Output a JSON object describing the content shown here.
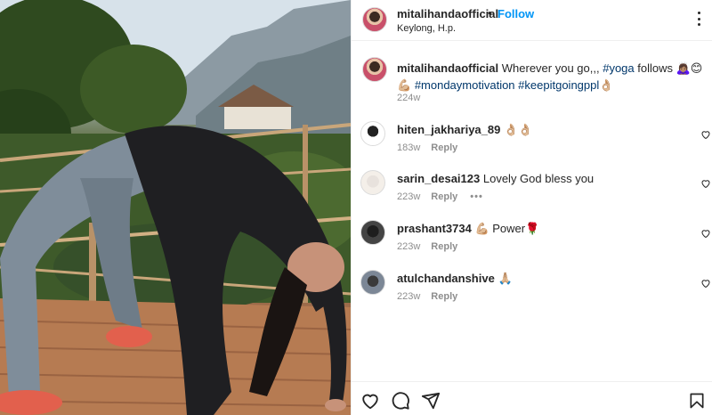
{
  "post": {
    "username": "mitalihandaofficial",
    "dot": "•",
    "follow_label": "Follow",
    "location": "Keylong, H.p."
  },
  "caption": {
    "username": "mitalihandaofficial",
    "text": "Wherever you go,,,",
    "tag_yoga": "#yoga",
    "follows": "follows 🙇🏽‍♀️😊💪🏼",
    "tag_monday": "#mondaymotivation",
    "tag_keep": "#keepitgoingppl",
    "trailing_emoji": "👌🏼",
    "age": "224w"
  },
  "comments": [
    {
      "username": "hiten_jakhariya_89",
      "text": "👌🏼👌🏼",
      "age": "183w",
      "reply": "Reply",
      "more": ""
    },
    {
      "username": "sarin_desai123",
      "text": "Lovely God bless you",
      "age": "223w",
      "reply": "Reply",
      "more": "•••"
    },
    {
      "username": "prashant3734",
      "text": "💪🏼 Power🌹",
      "age": "223w",
      "reply": "Reply",
      "more": ""
    },
    {
      "username": "atulchandanshive",
      "text": "🙏🏼",
      "age": "223w",
      "reply": "Reply",
      "more": ""
    }
  ],
  "icons": {
    "like": "heart-icon",
    "comment": "comment-bubble-icon",
    "share": "paper-plane-icon",
    "save": "bookmark-icon",
    "more": "more-options-icon"
  },
  "colors": {
    "accent": "#0095f6",
    "hashtag": "#00376b",
    "muted": "#8e8e8e"
  }
}
